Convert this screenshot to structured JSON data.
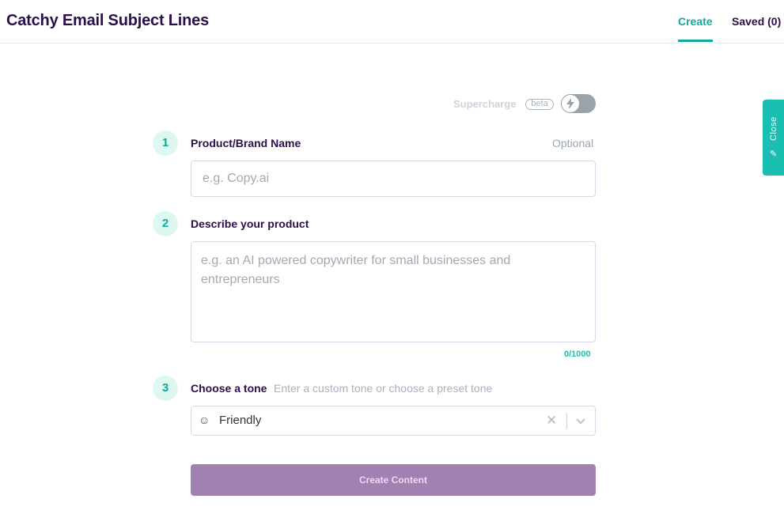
{
  "header": {
    "title": "Catchy Email Subject Lines",
    "tabs": [
      {
        "label": "Create",
        "active": true
      },
      {
        "label": "Saved (0)",
        "active": false
      }
    ]
  },
  "supercharge": {
    "label": "Supercharge",
    "badge": "beta",
    "toggle_on": false,
    "icon": "lightning-icon"
  },
  "side_tab": {
    "label": "Close",
    "icon": "pencil-icon"
  },
  "steps": [
    {
      "number": "1",
      "label": "Product/Brand Name",
      "optional_label": "Optional",
      "placeholder": "e.g. Copy.ai",
      "value": ""
    },
    {
      "number": "2",
      "label": "Describe your product",
      "placeholder": "e.g. an AI powered copywriter for small businesses and entrepreneurs",
      "value": "",
      "counter": "0/1000"
    },
    {
      "number": "3",
      "label": "Choose a tone",
      "hint": "Enter a custom tone or choose a preset tone",
      "selected": {
        "emoji": "☺",
        "value": "Friendly"
      }
    }
  ],
  "actions": {
    "create_label": "Create Content"
  },
  "colors": {
    "accent": "#14a89a",
    "title": "#2a0f4a",
    "button": "#a181b2",
    "side_tab": "#1bbfb2"
  }
}
